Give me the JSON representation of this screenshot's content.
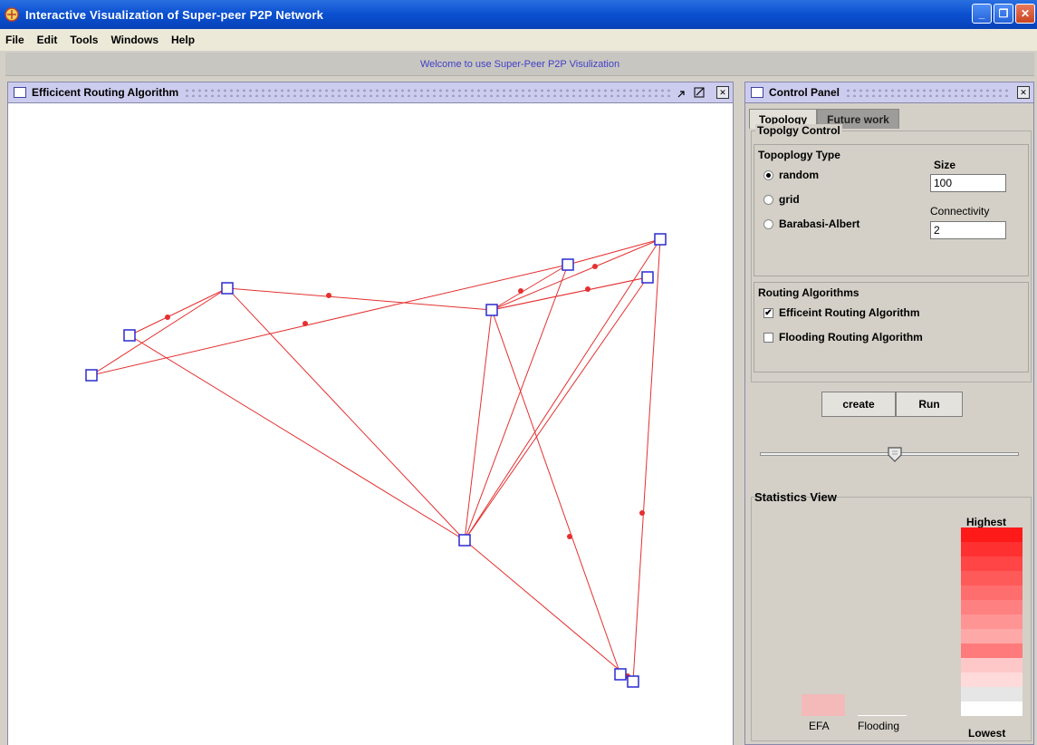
{
  "window": {
    "title": "Interactive Visualization of Super-peer P2P Network"
  },
  "menu": [
    "File",
    "Edit",
    "Tools",
    "Windows",
    "Help"
  ],
  "welcome_text": "Welcome to use Super-Peer P2P Visulization",
  "routing_frame": {
    "title": "Efficicent Routing  Algorithm"
  },
  "control_panel": {
    "title": "Control Panel",
    "tabs": [
      "Topology",
      "Future work"
    ],
    "topology_control_label": "Topolgy Control",
    "topology_type_label": "Topoplogy Type",
    "topology_types": [
      {
        "label": "random",
        "selected": true
      },
      {
        "label": "grid",
        "selected": false
      },
      {
        "label": "Barabasi-Albert",
        "selected": false
      }
    ],
    "size_label": "Size",
    "size_value": "100",
    "connectivity_label": "Connectivity",
    "connectivity_value": "2",
    "routing_label": "Routing Algorithms",
    "routing_options": [
      {
        "label": "Efficeint Routing Algorithm",
        "checked": true
      },
      {
        "label": "Flooding Routing Algorithm",
        "checked": false
      }
    ],
    "create_label": "create",
    "run_label": "Run",
    "slider_value": 0.53
  },
  "statistics": {
    "title": "Statistics View",
    "highest_label": "Highest",
    "lowest_label": "Lowest",
    "efa_label": "EFA",
    "flooding_label": "Flooding",
    "scale_colors": [
      "#ff1a1a",
      "#ff3030",
      "#ff4545",
      "#ff5a5a",
      "#ff6e6e",
      "#ff8080",
      "#ff9494",
      "#ffa8a8",
      "#ff7a7a",
      "#ffc8c8",
      "#ffdada",
      "#e6e6e6",
      "#ffffff"
    ]
  },
  "colors": {
    "edge": "#e53030",
    "node": "#2a2ad0",
    "titlebar": "#0a4fd0"
  }
}
